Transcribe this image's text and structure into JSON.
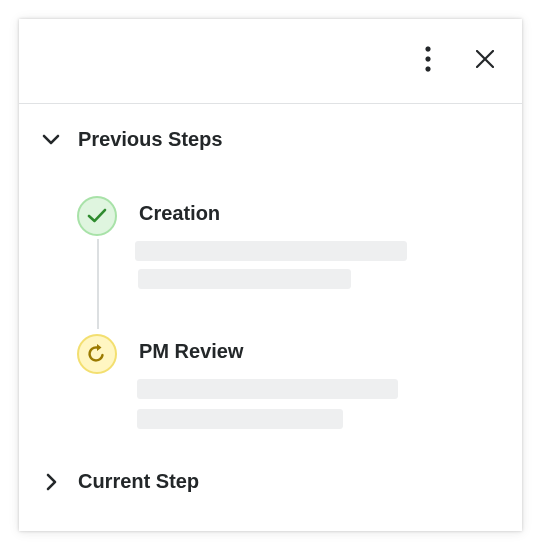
{
  "header": {
    "more_icon": "more-vertical-icon",
    "close_icon": "close-icon"
  },
  "sections": {
    "previous": {
      "label": "Previous Steps",
      "expanded": true,
      "steps": [
        {
          "title": "Creation",
          "status": "complete",
          "icon": "check-icon",
          "color": "#2e8b2e"
        },
        {
          "title": "PM Review",
          "status": "in-progress",
          "icon": "refresh-icon",
          "color": "#9a7a00"
        }
      ]
    },
    "current": {
      "label": "Current Step",
      "expanded": false
    }
  },
  "colors": {
    "text": "#232729",
    "divider": "#e0e2e4",
    "skeleton": "#eeeff0",
    "complete_bg": "#dff5df",
    "pending_bg": "#fff6c2"
  }
}
